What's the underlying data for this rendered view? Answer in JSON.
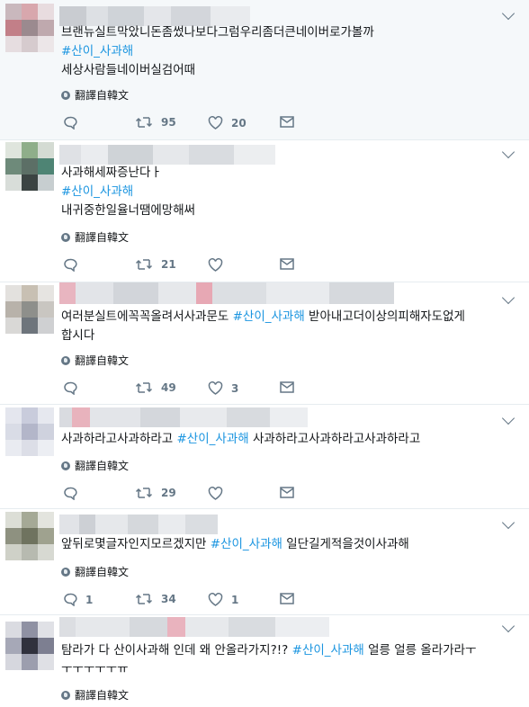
{
  "tweets": [
    {
      "lines": [
        {
          "text": "브랜뉴실트막았니돈좀썼나보다그럼우리좀더큰네이버로가볼까"
        },
        {
          "hashtag": "#산이_사과해"
        },
        {
          "text": "세상사람들네이버실검어때"
        }
      ],
      "translate": "翻譯自韓文",
      "counts": {
        "replies": "",
        "retweets": "95",
        "likes": "20"
      }
    },
    {
      "lines": [
        {
          "text": "사과해세짜증난다ㅏ"
        },
        {
          "hashtag": "#산이_사과해"
        },
        {
          "text": "내귀중한일율너땜에망해써"
        }
      ],
      "translate": "翻譯自韓文",
      "counts": {
        "replies": "",
        "retweets": "21",
        "likes": ""
      }
    },
    {
      "lines": [
        {
          "before": "여러분실트에꼭꼭올려서사과문도 ",
          "hashtag": "#산이_사과해",
          "after": " 받아내고더이상의피해자도없게"
        },
        {
          "text": "합시다"
        }
      ],
      "translate": "翻譯自韓文",
      "counts": {
        "replies": "",
        "retweets": "49",
        "likes": "3"
      }
    },
    {
      "lines": [
        {
          "before": "사과하라고사과하라고 ",
          "hashtag": "#산이_사과해",
          "after": " 사과하라고사과하라고사과하라고"
        }
      ],
      "translate": "翻譯自韓文",
      "counts": {
        "replies": "",
        "retweets": "29",
        "likes": ""
      }
    },
    {
      "lines": [
        {
          "before": "앞뒤로몇글자인지모르겠지만 ",
          "hashtag": "#산이_사과해",
          "after": " 일단길게적을것이사과해"
        }
      ],
      "translate": "翻譯自韓文",
      "counts": {
        "replies": "1",
        "retweets": "34",
        "likes": "1"
      }
    },
    {
      "lines": [
        {
          "before": "탐라가 다 산이사과해 인데 왜 안올라가지?!? ",
          "hashtag": "#산이_사과해",
          "after": " 얼릉 얼릉 올라가라ㅜ"
        },
        {
          "text": "ㅜㅜㅜㅜㅜㅠ"
        }
      ],
      "translate": "翻譯自韓文",
      "counts": {
        "replies": "",
        "retweets": "",
        "likes": ""
      }
    }
  ],
  "icons": {
    "reply": "reply-icon",
    "retweet": "retweet-icon",
    "like": "heart-icon",
    "dm": "direct-message-icon",
    "translate": "globe-icon",
    "more": "chevron-down-icon"
  },
  "colors": {
    "hashtag": "#1b95e0",
    "action": "#657786",
    "highlight_bg": "#f5f8fa",
    "divider": "#e6ecf0"
  }
}
